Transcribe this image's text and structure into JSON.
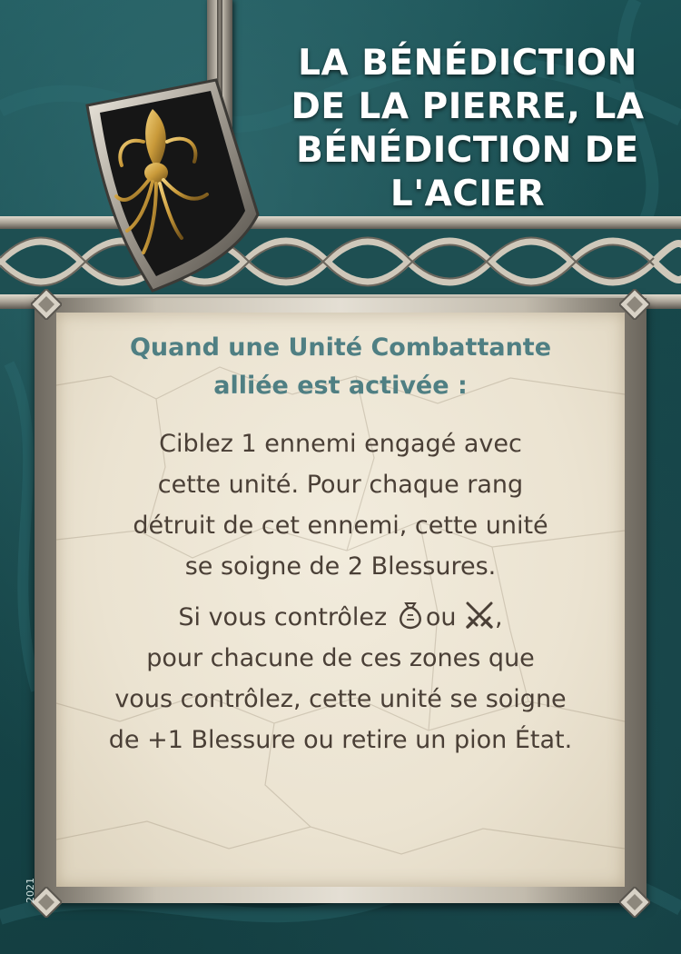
{
  "card": {
    "title_lines": [
      "LA BÉNÉDICTION",
      "DE LA PIERRE, LA",
      "BÉNÉDICTION DE",
      "L'ACIER"
    ],
    "trigger_lines": [
      "Quand une Unité Combattante",
      "alliée est activée :"
    ],
    "effect_paragraph_1": [
      "Ciblez 1 ennemi engagé avec",
      "cette unité. Pour chaque rang",
      "détruit de cet ennemi, cette unité",
      "se soigne de 2 Blessures."
    ],
    "effect_paragraph_2": {
      "line1_start": "Si vous contrôlez",
      "line1_middle": "ou",
      "line1_end": ",",
      "lines": [
        "pour chacune de ces zones que",
        "vous contrôlez, cette unité se soigne",
        "de +1 Blessure ou retire un pion État."
      ]
    },
    "year": "2021",
    "icons": {
      "house_sigil": "kraken-icon",
      "zone_1": "money-bag-icon",
      "zone_2": "crossed-swords-icon"
    }
  },
  "colors": {
    "background_teal": "#164649",
    "title_text": "#ffffff",
    "trigger_text": "#4f7f83",
    "body_text": "#4a3f36",
    "parchment": "#ebe3d1",
    "sigil_gold": "#c99a3a"
  }
}
